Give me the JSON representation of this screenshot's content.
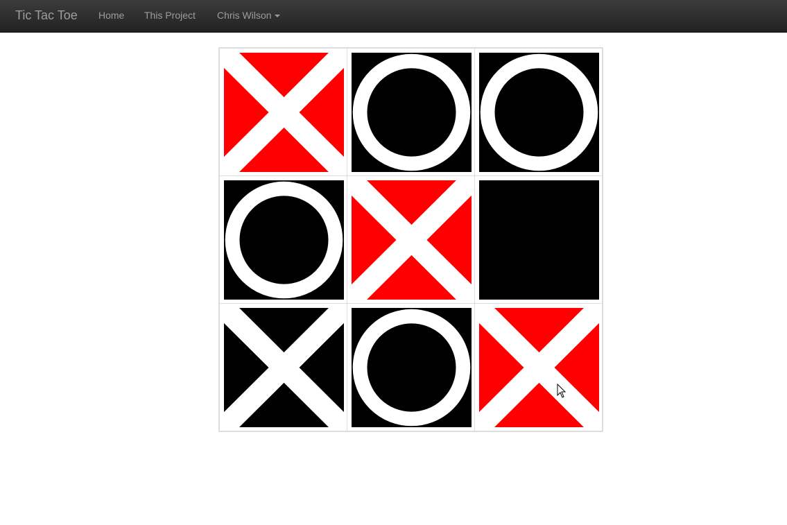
{
  "navbar": {
    "brand": "Tic Tac Toe",
    "links": [
      {
        "label": "Home"
      },
      {
        "label": "This Project"
      },
      {
        "label": "Chris Wilson"
      }
    ]
  },
  "colors": {
    "winning_background": "#ff0000",
    "normal_background": "#000000",
    "mark": "#ffffff"
  },
  "board": {
    "cells": [
      {
        "mark": "X",
        "highlight": true
      },
      {
        "mark": "O",
        "highlight": false
      },
      {
        "mark": "O",
        "highlight": false
      },
      {
        "mark": "O",
        "highlight": false
      },
      {
        "mark": "X",
        "highlight": true
      },
      {
        "mark": "",
        "highlight": false
      },
      {
        "mark": "X",
        "highlight": false
      },
      {
        "mark": "O",
        "highlight": false
      },
      {
        "mark": "X",
        "highlight": true
      }
    ]
  }
}
